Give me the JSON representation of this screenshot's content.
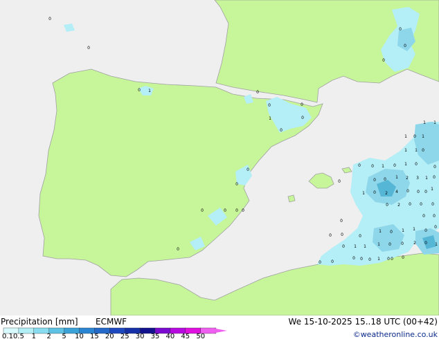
{
  "map": {
    "title": "Precipitation [mm]",
    "model": "ECMWF",
    "valid_time": "We 15-10-2025 15..18 UTC (00+42)",
    "credit": "©weatheronline.co.uk",
    "colors": {
      "sea": "#efefef",
      "land": "#c6f59a",
      "coast": "#a0a0a0",
      "rain_light": "#b4eef6",
      "rain_mid": "#8ed6ea",
      "rain_heavy": "#56b6d6"
    },
    "legend": {
      "ticks": [
        "0.1",
        "0.5",
        "1",
        "2",
        "5",
        "10",
        "15",
        "20",
        "25",
        "30",
        "35",
        "40",
        "45",
        "50"
      ],
      "colors": [
        "#d8fafc",
        "#b2eef6",
        "#88dcef",
        "#5ec2e4",
        "#3aa2d6",
        "#2a86d2",
        "#2468c8",
        "#1e48c0",
        "#1630a8",
        "#12128e",
        "#7a0ad0",
        "#b60ae0",
        "#e010e0",
        "#f060f0"
      ]
    },
    "grid_labels": [
      "0",
      "0",
      "0",
      "0",
      "1",
      "0",
      "1",
      "0",
      "0",
      "0",
      "0",
      "0",
      "0",
      "0",
      "0",
      "0",
      "0",
      "0",
      "0",
      "0",
      "0",
      "0",
      "0",
      "0",
      "1",
      "0",
      "0",
      "0",
      "1",
      "1",
      "1",
      "0",
      "1",
      "1",
      "1",
      "0",
      "0",
      "1",
      "0",
      "1",
      "0",
      "0",
      "0",
      "1",
      "2",
      "3",
      "1",
      "1",
      "0",
      "2",
      "4",
      "0",
      "0",
      "1",
      "0",
      "2",
      "0",
      "0",
      "0",
      "0",
      "0",
      "1",
      "0",
      "1",
      "1",
      "0",
      "0",
      "1",
      "1",
      "1",
      "0",
      "0",
      "2",
      "0",
      "1",
      "0",
      "0",
      "0",
      "0",
      "0",
      "0",
      "0",
      "0",
      "0",
      "0",
      "0"
    ]
  }
}
